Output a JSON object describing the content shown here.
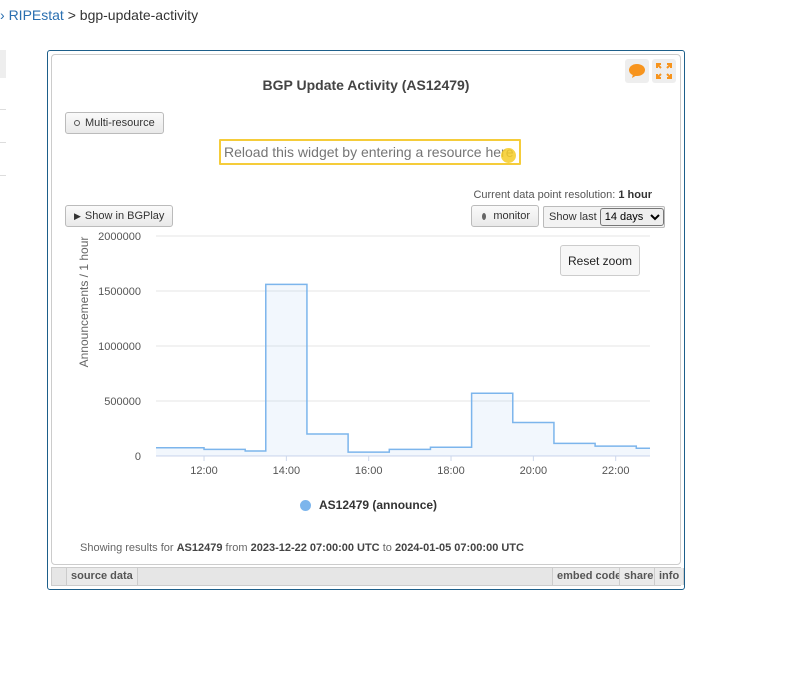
{
  "breadcrumb": {
    "chevron": "›",
    "root": "RIPEstat",
    "separator": ">",
    "current": "bgp-update-activity"
  },
  "widget": {
    "title": "BGP Update Activity (AS12479)",
    "icons": [
      "speech-bubble-icon",
      "expand-icon"
    ],
    "multi_resource_label": "Multi-resource",
    "resource_placeholder": "Reload this widget by entering a resource here",
    "resolution_label": "Current data point resolution:",
    "resolution_value": "1 hour",
    "show_in_bgplay_label": "Show in BGPlay",
    "monitor_label": "monitor",
    "show_last_label": "Show last",
    "show_last_selected": "14 days",
    "reset_zoom_label": "Reset zoom",
    "results_prefix": "Showing results for",
    "results_resource": "AS12479",
    "results_from_label": "from",
    "results_from": "2023-12-22 07:00:00 UTC",
    "results_to_label": "to",
    "results_to": "2024-01-05 07:00:00 UTC"
  },
  "footer": {
    "source_data": "source data",
    "embed_code": "embed code",
    "share": "share",
    "info": "info"
  },
  "colors": {
    "series": "#7cb5ec",
    "frame": "#1d5f8a",
    "highlight": "#f5cc3a",
    "icon_accent": "#f7941d"
  },
  "chart_data": {
    "type": "area",
    "step": true,
    "title": "",
    "xlabel": "",
    "ylabel": "Announcements / 1 hour",
    "x": [
      "10:50",
      "12:00",
      "13:00",
      "13:30",
      "14:30",
      "15:30",
      "16:30",
      "17:30",
      "18:30",
      "19:30",
      "20:30",
      "21:30",
      "22:30",
      "22:50"
    ],
    "y_tick_labels": [
      "0",
      "500000",
      "1000000",
      "1500000",
      "2000000"
    ],
    "x_tick_labels": [
      "12:00",
      "14:00",
      "16:00",
      "18:00",
      "20:00",
      "22:00"
    ],
    "ylim": [
      0,
      2000000
    ],
    "grid": true,
    "legend_position": "bottom",
    "series": [
      {
        "name": "AS12479 (announce)",
        "values": [
          75000,
          60000,
          45000,
          1560000,
          200000,
          35000,
          60000,
          80000,
          570000,
          305000,
          115000,
          90000,
          70000,
          70000
        ]
      }
    ]
  }
}
